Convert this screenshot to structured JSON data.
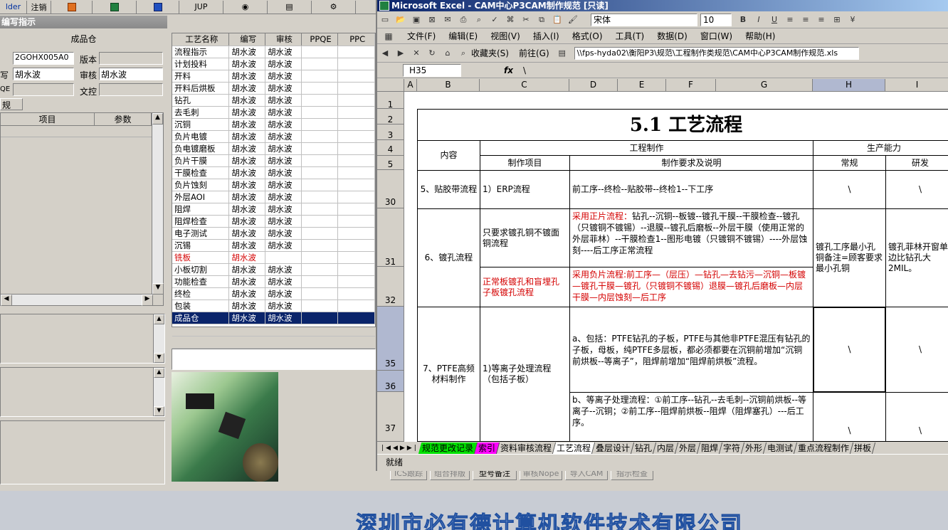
{
  "left_toolbar": {
    "b0": "lder",
    "b1": "注销",
    "b4": "JUP"
  },
  "left_title": "编写指示",
  "left_form": {
    "warehouse": "成品仓",
    "part_no": "2GOHX005A0",
    "version_label": "版本",
    "writer_label": "写",
    "writer": "胡水波",
    "review_label": "审核",
    "reviewer": "胡水波",
    "qe_label": "QE",
    "doc_label": "文控",
    "gui_label": "规",
    "item_col": "项目",
    "param_col": "参数"
  },
  "process_table": {
    "headers": [
      "工艺名称",
      "编写",
      "审核",
      "PPQE",
      "PPC"
    ],
    "rows": [
      [
        "流程指示",
        "胡水波",
        "胡水波"
      ],
      [
        "计划投料",
        "胡水波",
        "胡水波"
      ],
      [
        "开料",
        "胡水波",
        "胡水波"
      ],
      [
        "开料后烘板",
        "胡水波",
        "胡水波"
      ],
      [
        "钻孔",
        "胡水波",
        "胡水波"
      ],
      [
        "去毛刺",
        "胡水波",
        "胡水波"
      ],
      [
        "沉铜",
        "胡水波",
        "胡水波"
      ],
      [
        "负片电镀",
        "胡水波",
        "胡水波"
      ],
      [
        "负电镀磨板",
        "胡水波",
        "胡水波"
      ],
      [
        "负片干膜",
        "胡水波",
        "胡水波"
      ],
      [
        "干膜检查",
        "胡水波",
        "胡水波"
      ],
      [
        "负片蚀刻",
        "胡水波",
        "胡水波"
      ],
      [
        "外层AOI",
        "胡水波",
        "胡水波"
      ],
      [
        "阻焊",
        "胡水波",
        "胡水波"
      ],
      [
        "阻焊检查",
        "胡水波",
        "胡水波"
      ],
      [
        "电子测试",
        "胡水波",
        "胡水波"
      ],
      [
        "沉锡",
        "胡水波",
        "胡水波"
      ],
      [
        "铣板",
        "胡水波",
        ""
      ],
      [
        "小板切割",
        "胡水波",
        "胡水波"
      ],
      [
        "功能检查",
        "胡水波",
        "胡水波"
      ],
      [
        "终检",
        "胡水波",
        "胡水波"
      ],
      [
        "包装",
        "胡水波",
        "胡水波"
      ],
      [
        "成品仓",
        "胡水波",
        "胡水波"
      ]
    ]
  },
  "bottom_buttons": [
    "ICS跟踪",
    "组合排版",
    "型号备注",
    "审核Nope",
    "导入CAM",
    "指示检查"
  ],
  "excel": {
    "title": "Microsoft Excel - CAM中心P3CAM制作规范 [只读]",
    "font_name": "宋体",
    "font_size": "10",
    "menus": [
      "文件(F)",
      "编辑(E)",
      "视图(V)",
      "插入(I)",
      "格式(O)",
      "工具(T)",
      "数据(D)",
      "窗口(W)",
      "帮助(H)"
    ],
    "favorites": "收藏夹(S)",
    "goto": "前往(G)",
    "path": "\\\\fps-hyda02\\衡阳P3\\规范\\工程制作类规范\\CAM中心P3CAM制作规范.xls",
    "name_box": "H35",
    "fx": "fx",
    "formula": "\\",
    "columns": [
      "A",
      "B",
      "C",
      "D",
      "E",
      "F",
      "G",
      "H",
      "I"
    ],
    "row_numbers": [
      "1",
      "2",
      "3",
      "4",
      "5",
      "30",
      "31",
      "32",
      "35",
      "36",
      "37"
    ],
    "sheet_title": "5.1  工艺流程",
    "hdr_content": "内容",
    "hdr_eng": "工程制作",
    "hdr_capacity": "生产能力",
    "hdr_item": "制作项目",
    "hdr_req": "制作要求及说明",
    "hdr_normal": "常规",
    "hdr_rd": "研发",
    "r30_b": "5、贴胶带流程",
    "r30_c": "1）ERP流程",
    "r30_d": "前工序--终检--贴胶带--终检1--下工序",
    "r30_h": "\\",
    "r30_i": "\\",
    "r31_b": "6、镀孔流程",
    "r31_c": "只要求镀孔铜不镀面铜流程",
    "r31_d_red": "采用正片流程：",
    "r31_d": "钻孔--沉铜--板镀--镀孔干膜--干膜检查--镀孔（只镀铜不镀锡）--退膜--镀孔后磨板--外层干膜（使用正常的外层菲林）--干膜检查1--图形电镀（只镀铜不镀锡）----外层蚀刻----后工序正常流程",
    "r31_h": "镀孔工序最小孔铜备注=顾客要求最小孔铜",
    "r31_i": "镀孔菲林开窗单边比钻孔大2MIL。",
    "r32_c": "正常板镀孔和盲埋孔子板镀孔流程",
    "r32_d": "采用负片流程:前工序—（层压）—钻孔—去钻污—沉铜—板镀—镀孔干膜—镀孔（只镀铜不镀锡）退膜—镀孔后磨板—内层干膜—内层蚀刻—后工序",
    "r35_b": "7、PTFE高频材料制作",
    "r35_c": "1)等离子处理流程（包括子板）",
    "r35_d": "a、包括：PTFE钻孔的子板，PTFE与其他非PTFE混压有钻孔的子板，母板，纯PTFE多层板，都必须都要在沉铜前增加“沉铜前烘板--等离子”，阻焊前增加“阻焊前烘板”流程。",
    "r35_h": "\\",
    "r35_i": "\\",
    "r37_d": "b、等离子处理流程：①前工序--钻孔--去毛刺--沉铜前烘板--等离子--沉铜；②前工序--阻焊前烘板--阻焊（阻焊塞孔）---后工序。",
    "r37_h": "\\",
    "r37_i": "\\",
    "tabs": [
      "规范更改记录",
      "索引",
      "资料审核流程",
      "工艺流程",
      "叠层设计",
      "钻孔",
      "内层",
      "外层",
      "阻焊",
      "字符",
      "外形",
      "电测试",
      "重点流程制作",
      "拼板"
    ],
    "status": "就绪"
  },
  "banner": "深圳市必有德计算机软件技术有限公司",
  "colors": {
    "selection": "#0a246a",
    "red_text": "#d40000",
    "tab_green": "#00e000",
    "tab_magenta": "#ff00ff"
  }
}
